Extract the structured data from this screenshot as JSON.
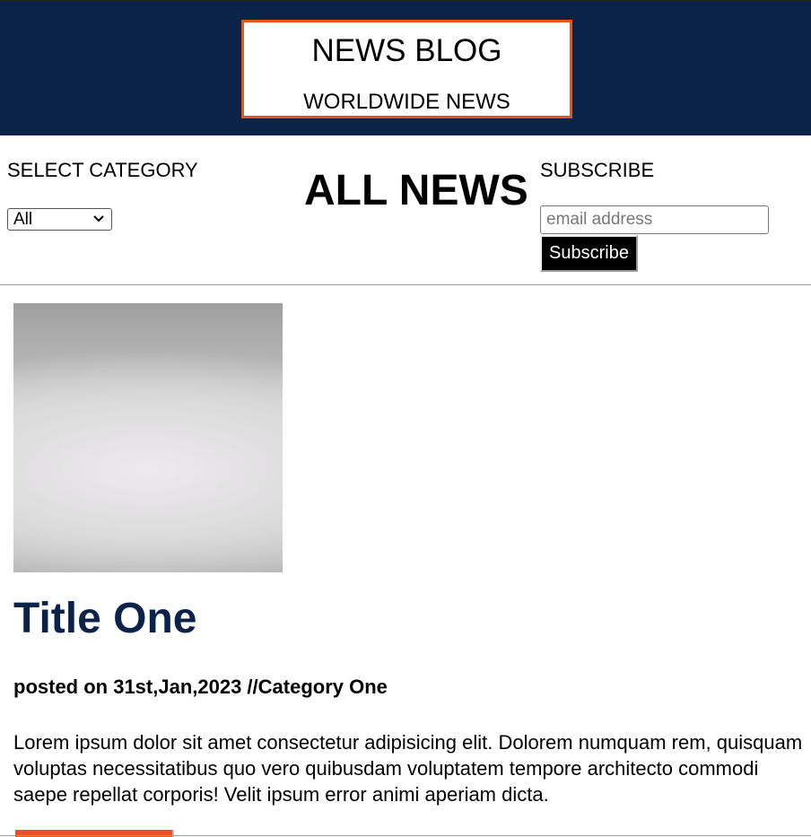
{
  "header": {
    "brand_title": "NEWS BLOG",
    "brand_subtitle": "WORLDWIDE NEWS",
    "background_color": "#0b2349",
    "accent_color": "#e8541e"
  },
  "controls": {
    "category_label": "SELECT CATEGORY",
    "category_selected": "All",
    "page_heading": "ALL NEWS",
    "subscribe_label": "SUBSCRIBE",
    "email_placeholder": "email address",
    "email_value": "",
    "subscribe_button": "Subscribe"
  },
  "article": {
    "title": "Title One",
    "meta": "posted on 31st,Jan,2023 //Category One",
    "body": "Lorem ipsum dolor sit amet consectetur adipisicing elit. Dolorem numquam rem, quisquam voluptas necessitatibus quo vero quibusdam voluptatem tempore architecto commodi saepe repellat corporis! Velit ipsum error animi aperiam dicta.",
    "title_color": "#0b2349",
    "button_color": "#e8541e"
  }
}
